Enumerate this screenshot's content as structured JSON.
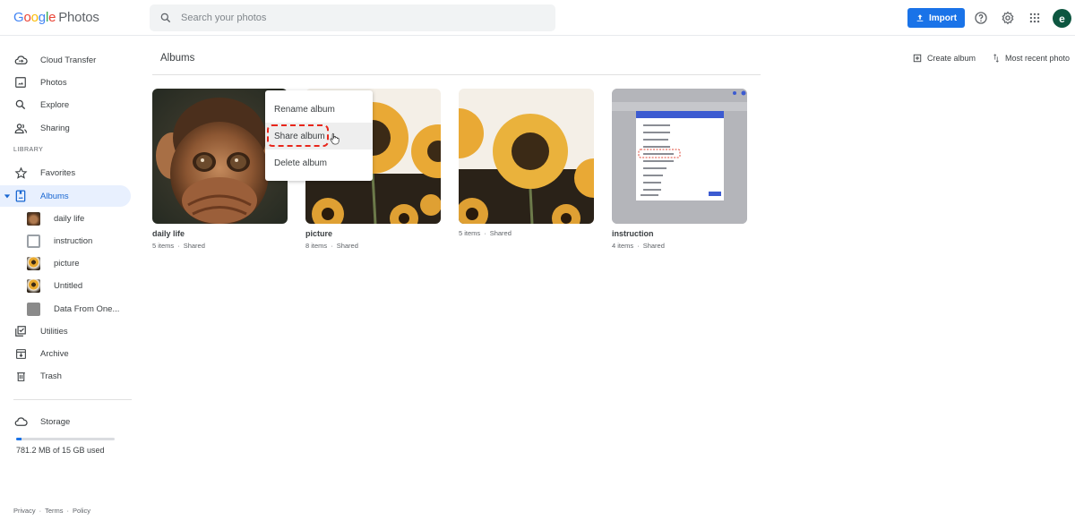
{
  "app": {
    "logo_letters": [
      "G",
      "o",
      "o",
      "g",
      "l",
      "e"
    ],
    "product": "Photos"
  },
  "header": {
    "search_placeholder": "Search your photos",
    "import_label": "Import",
    "icons": [
      "upload-icon",
      "help-icon",
      "settings-icon",
      "apps-grid-icon"
    ],
    "avatar_letter": "e",
    "avatar_color": "#0d5640"
  },
  "sidebar": {
    "items": [
      {
        "label": "Cloud Transfer",
        "icon": "cloud-transfer-icon"
      },
      {
        "label": "Photos",
        "icon": "photo-icon"
      },
      {
        "label": "Explore",
        "icon": "search-icon"
      },
      {
        "label": "Sharing",
        "icon": "people-icon"
      }
    ],
    "library_label": "LIBRARY",
    "library_items": [
      {
        "label": "Favorites",
        "icon": "star-icon"
      },
      {
        "label": "Albums",
        "icon": "album-icon",
        "active": true
      }
    ],
    "albums": [
      {
        "label": "daily life"
      },
      {
        "label": "instruction"
      },
      {
        "label": "picture"
      },
      {
        "label": "Untitled"
      },
      {
        "label": "Data From One..."
      }
    ],
    "more_items": [
      {
        "label": "Utilities",
        "icon": "utilities-icon"
      },
      {
        "label": "Archive",
        "icon": "archive-icon"
      },
      {
        "label": "Trash",
        "icon": "trash-icon"
      }
    ],
    "storage": {
      "label": "Storage",
      "used_text": "781.2 MB of 15 GB used",
      "used_fraction": 0.052
    },
    "footer": [
      "Privacy",
      "Terms",
      "Policy"
    ]
  },
  "main": {
    "title": "Albums",
    "create_album_label": "Create album",
    "sort_label": "Most recent photo",
    "albums": [
      {
        "name": "daily life",
        "items": "5 items",
        "status": "Shared"
      },
      {
        "name": "picture",
        "items": "8 items",
        "status": "Shared"
      },
      {
        "name": "",
        "items": "5 items",
        "status": "Shared"
      },
      {
        "name": "instruction",
        "items": "4 items",
        "status": "Shared"
      }
    ]
  },
  "context_menu": {
    "items": [
      "Rename album",
      "Share album",
      "Delete album"
    ],
    "highlighted": "Share album",
    "highlight_color": "#e8261b"
  }
}
